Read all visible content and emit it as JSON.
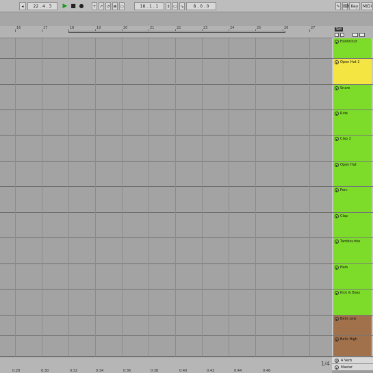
{
  "transport": {
    "tempo_nudge": "◂",
    "position": "22 . 4 . 3",
    "play": "▶",
    "stop": "■",
    "record": "●",
    "loop_start": "18 . 1 . 1",
    "loop_length": "8 . 0 . 0",
    "key_label": "Key",
    "midi_label": "MIDI"
  },
  "ruler": {
    "bars": [
      "16",
      "17",
      "18",
      "19",
      "20",
      "21",
      "22",
      "23",
      "24",
      "25",
      "26",
      "27"
    ]
  },
  "bottom_ruler": {
    "times": [
      "0:28",
      "0:30",
      "0:32",
      "0:34",
      "0:36",
      "0:38",
      "0:40",
      "0:42",
      "0:44",
      "0:46"
    ]
  },
  "page_indicator": "1/4",
  "right_panel": {
    "set_label": "Set"
  },
  "tracks": [
    {
      "name": "Hohhhhch",
      "color": "#7ddc2a",
      "toggle": "▸"
    },
    {
      "name": "Open Hat 2",
      "color": "#f4e542",
      "toggle": "▸"
    },
    {
      "name": "Snare",
      "color": "#7ddc2a",
      "toggle": "▸"
    },
    {
      "name": "Ride",
      "color": "#7ddc2a",
      "toggle": "▸"
    },
    {
      "name": "Clap 2",
      "color": "#7ddc2a",
      "toggle": "▸"
    },
    {
      "name": "Open Hat",
      "color": "#7ddc2a",
      "toggle": "▸"
    },
    {
      "name": "Perc",
      "color": "#7ddc2a",
      "toggle": "▸"
    },
    {
      "name": "Clap",
      "color": "#7ddc2a",
      "toggle": "▸"
    },
    {
      "name": "Tambourine",
      "color": "#7ddc2a",
      "toggle": "▸"
    },
    {
      "name": "Hats",
      "color": "#7ddc2a",
      "toggle": "▸"
    },
    {
      "name": "Kick & Bass",
      "color": "#7ddc2a",
      "toggle": "▸"
    },
    {
      "name": "Bells Low",
      "color": "#a0714a",
      "toggle": "▸"
    },
    {
      "name": "Bells High",
      "color": "#a0714a",
      "toggle": "▸"
    }
  ],
  "returns": [
    {
      "name": "A Verb",
      "toggle": "A"
    },
    {
      "name": "Master",
      "toggle": "▸"
    }
  ],
  "colors": {
    "green": "#2fd42f",
    "yellow": "#f4e542",
    "cyan": "#27e0e6",
    "white": "#ffffff",
    "red": "#e02525",
    "brown": "#a0714a"
  }
}
